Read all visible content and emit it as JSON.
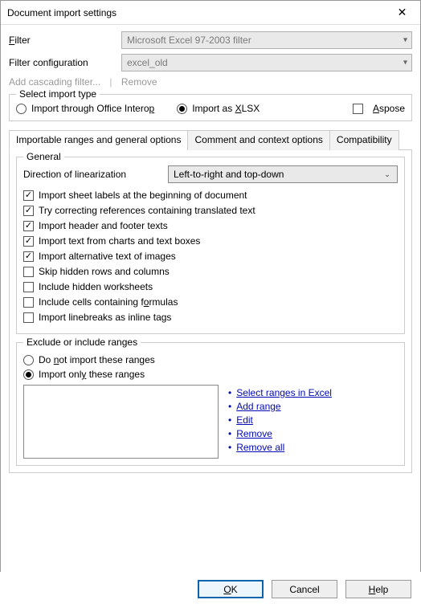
{
  "title": "Document import settings",
  "filter": {
    "label": "Filter",
    "accel": "F",
    "value": "Microsoft Excel 97-2003 filter"
  },
  "filter_config": {
    "label": "Filter configuration",
    "value": "excel_old"
  },
  "cascading": {
    "add": "Add cascading filter...",
    "remove": "Remove"
  },
  "import_type": {
    "legend": "Select import type",
    "opt_interop": "Import through Office Interop",
    "opt_interop_accel": "p",
    "opt_xlsx_pre": "Import as ",
    "opt_xlsx_accel": "X",
    "opt_xlsx_post": "LSX",
    "opt_aspose": "Aspose",
    "opt_aspose_accel": "A",
    "selected": "xlsx",
    "aspose_checked": false
  },
  "tabs": {
    "t1": "Importable ranges and general options",
    "t2": "Comment and context options",
    "t3": "Compatibility",
    "active": 0
  },
  "general": {
    "legend": "General",
    "direction_label": "Direction of linearization",
    "direction_value": "Left-to-right and top-down",
    "checks": [
      {
        "label": "Import sheet labels at the beginning of document",
        "checked": true
      },
      {
        "label": "Try correcting references containing translated text",
        "checked": true
      },
      {
        "label": "Import header and footer texts",
        "checked": true
      },
      {
        "label": "Import text from charts and text boxes",
        "checked": true
      },
      {
        "label": "Import alternative text of images",
        "checked": true
      },
      {
        "label": "Skip hidden rows and columns",
        "checked": false
      },
      {
        "label": "Include hidden worksheets",
        "checked": false
      },
      {
        "label_pre": "Include cells containing f",
        "label_accel": "o",
        "label_post": "rmulas",
        "checked": false
      },
      {
        "label": "Import linebreaks as inline tags",
        "checked": false
      }
    ]
  },
  "ranges": {
    "legend": "Exclude or include ranges",
    "opt_not_pre": "Do ",
    "opt_not_accel": "n",
    "opt_not_post": "ot import these ranges",
    "opt_only_pre": "Import onl",
    "opt_only_accel": "y",
    "opt_only_post": " these ranges",
    "selected": "only",
    "links": {
      "select_pre": "S",
      "select_post": "elect ranges in Excel",
      "add_pre": "A",
      "add_post": "dd range",
      "edit_pre": "E",
      "edit_post": "dit",
      "remove_pre": "R",
      "remove_post": "emove",
      "removeall_pre": "Remove a",
      "removeall_accel": "l",
      "removeall_post": "l"
    }
  },
  "buttons": {
    "ok": "OK",
    "ok_accel": "O",
    "cancel": "Cancel",
    "help": "Help",
    "help_accel": "H"
  }
}
